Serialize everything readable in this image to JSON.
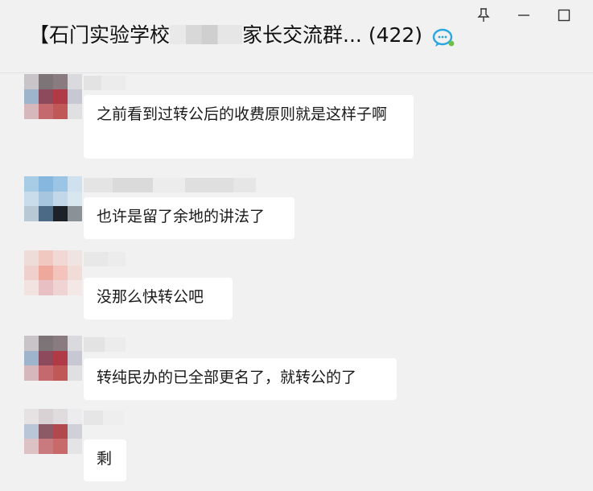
{
  "window": {
    "title_prefix": "【石门实验学校",
    "title_suffix": "家长交流群...",
    "member_count": "(422)",
    "icons": [
      "pin-icon",
      "minimize-icon",
      "maximize-icon",
      "chat-bubbles-icon"
    ]
  },
  "messages": [
    {
      "text": "之前看到过转公后的收费原则就是这样子啊"
    },
    {
      "text": "也许是留了余地的讲法了"
    },
    {
      "text": "没那么快转公吧"
    },
    {
      "text": "转纯民办的已全部更名了，就转公的了"
    },
    {
      "text": "剩"
    }
  ],
  "colors": {
    "background": "#f1f1f1",
    "bubble": "#ffffff",
    "text": "#1a1a1a",
    "chat_icon_blue": "#2aa7e0",
    "chat_icon_green": "#6cc04a"
  }
}
